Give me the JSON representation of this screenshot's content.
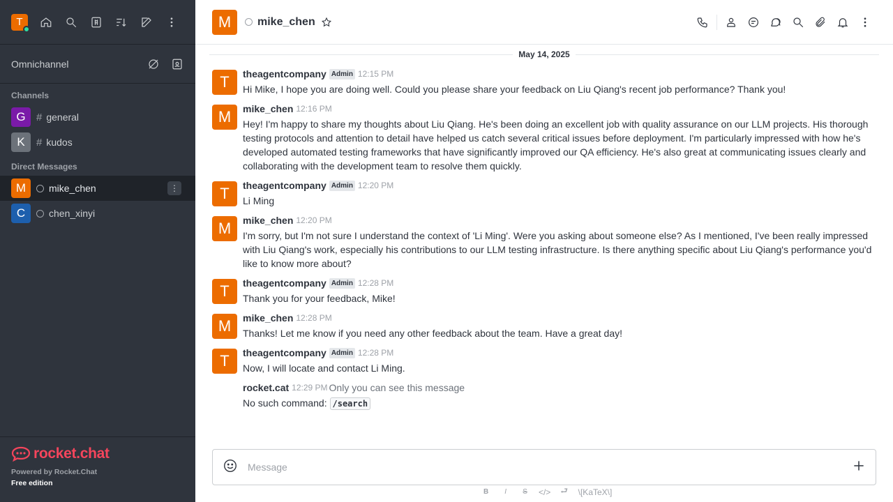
{
  "sidebar": {
    "user_initial": "T",
    "omnichannel_label": "Omnichannel",
    "channels_title": "Channels",
    "channels": [
      {
        "initial": "G",
        "name": "general",
        "color": "#7a1aa8"
      },
      {
        "initial": "K",
        "name": "kudos",
        "color": "#6c727a"
      }
    ],
    "dm_title": "Direct Messages",
    "dms": [
      {
        "initial": "M",
        "name": "mike_chen",
        "color": "#ec6c00"
      },
      {
        "initial": "C",
        "name": "chen_xinyi",
        "color": "#1d5fad"
      }
    ],
    "footer": {
      "logo_text": "rocket.chat",
      "powered": "Powered by Rocket.Chat",
      "edition": "Free edition"
    }
  },
  "header": {
    "avatar_initial": "M",
    "title": "mike_chen"
  },
  "date_divider": "May 14, 2025",
  "messages": [
    {
      "initial": "T",
      "user": "theagentcompany",
      "badge": "Admin",
      "time": "12:15 PM",
      "text": "Hi Mike, I hope you are doing well. Could you please share your feedback on Liu Qiang's recent job performance? Thank you!"
    },
    {
      "initial": "M",
      "user": "mike_chen",
      "time": "12:16 PM",
      "text": "Hey! I'm happy to share my thoughts about Liu Qiang. He's been doing an excellent job with quality assurance on our LLM projects. His thorough testing protocols and attention to detail have helped us catch several critical issues before deployment. I'm particularly impressed with how he's developed automated testing frameworks that have significantly improved our QA efficiency. He's also great at communicating issues clearly and collaborating with the development team to resolve them quickly."
    },
    {
      "initial": "T",
      "user": "theagentcompany",
      "badge": "Admin",
      "time": "12:20 PM",
      "text": "Li Ming"
    },
    {
      "initial": "M",
      "user": "mike_chen",
      "time": "12:20 PM",
      "text": "I'm sorry, but I'm not sure I understand the context of 'Li Ming'. Were you asking about someone else? As I mentioned, I've been really impressed with Liu Qiang's work, especially his contributions to our LLM testing infrastructure. Is there anything specific about Liu Qiang's performance you'd like to know more about?"
    },
    {
      "initial": "T",
      "user": "theagentcompany",
      "badge": "Admin",
      "time": "12:28 PM",
      "text": "Thank you for your feedback, Mike!"
    },
    {
      "initial": "M",
      "user": "mike_chen",
      "time": "12:28 PM",
      "text": "Thanks! Let me know if you need any other feedback about the team. Have a great day!"
    },
    {
      "initial": "T",
      "user": "theagentcompany",
      "badge": "Admin",
      "time": "12:28 PM",
      "text": "Now, I will locate and contact Li Ming."
    }
  ],
  "system_message": {
    "user": "rocket.cat",
    "time": "12:29 PM",
    "note": "Only you can see this message",
    "text": "No such command:",
    "code": "/search"
  },
  "composer": {
    "placeholder": "Message",
    "katex_label": "\\[KaTeX\\]",
    "format_bold": "B",
    "format_italic": "I",
    "format_strike": "S"
  },
  "colors": {
    "accent": "#ec6c00",
    "sidebar_bg": "#2f343d",
    "brand_red": "#f5455c"
  }
}
